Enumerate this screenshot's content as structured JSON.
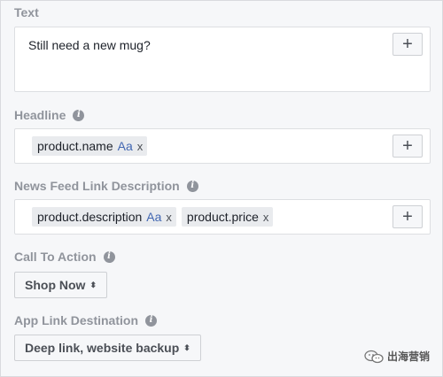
{
  "text_section": {
    "label": "Text",
    "value": "Still need a new mug?",
    "add_label": "+"
  },
  "headline_section": {
    "label": "Headline",
    "info_icon": "i",
    "tokens": [
      {
        "text": "product.name",
        "aa": "Aa",
        "remove": "x"
      }
    ],
    "add_label": "+"
  },
  "link_description_section": {
    "label": "News Feed Link Description",
    "info_icon": "i",
    "tokens": [
      {
        "text": "product.description",
        "aa": "Aa",
        "remove": "x"
      },
      {
        "text": "product.price",
        "remove": "x"
      }
    ],
    "add_label": "+"
  },
  "call_to_action": {
    "label": "Call To Action",
    "info_icon": "i",
    "selected": "Shop Now",
    "caret": "⬍"
  },
  "app_link_destination": {
    "label": "App Link Destination",
    "info_icon": "i",
    "selected": "Deep link, website backup",
    "caret": "⬍"
  },
  "watermark": {
    "text": "出海营销",
    "icon": "wechat-icon"
  },
  "colors": {
    "background": "#f6f7f9",
    "label": "#90949c",
    "accent": "#4267b2",
    "token_bg": "#e9ebee"
  }
}
